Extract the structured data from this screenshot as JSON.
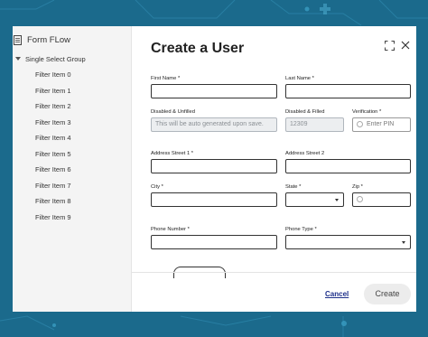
{
  "sidebar": {
    "title": "Form FLow",
    "group": "Single Select Group",
    "items": [
      "Filter Item 0",
      "Filter Item 1",
      "Filter Item 2",
      "Filter Item 3",
      "Filter Item 4",
      "Filter Item 5",
      "Filter Item 6",
      "Filter Item 7",
      "Filter Item 8",
      "Filter Item 9"
    ]
  },
  "dialog": {
    "title": "Create a User",
    "fields": {
      "first_name": {
        "label": "First Name *"
      },
      "last_name": {
        "label": "Last Name *"
      },
      "disabled_unfilled": {
        "label": "Disabled & Unfilled",
        "placeholder": "This will be auto generated upon save."
      },
      "disabled_filled": {
        "label": "Disabled & Filled",
        "value": "12309"
      },
      "verification": {
        "label": "Verification *",
        "placeholder": "Enter PIN"
      },
      "address1": {
        "label": "Address Street 1 *"
      },
      "address2": {
        "label": "Address Street 2"
      },
      "city": {
        "label": "City *"
      },
      "state": {
        "label": "State *"
      },
      "zip": {
        "label": "Zip *"
      },
      "phone_number": {
        "label": "Phone Number *"
      },
      "phone_type": {
        "label": "Phone Type *"
      }
    },
    "cancel_label": "Cancel",
    "create_label": "Create"
  },
  "colors": {
    "background": "#1b6a8c",
    "link": "#1d2f8a",
    "create_button_bg": "#ececec"
  }
}
